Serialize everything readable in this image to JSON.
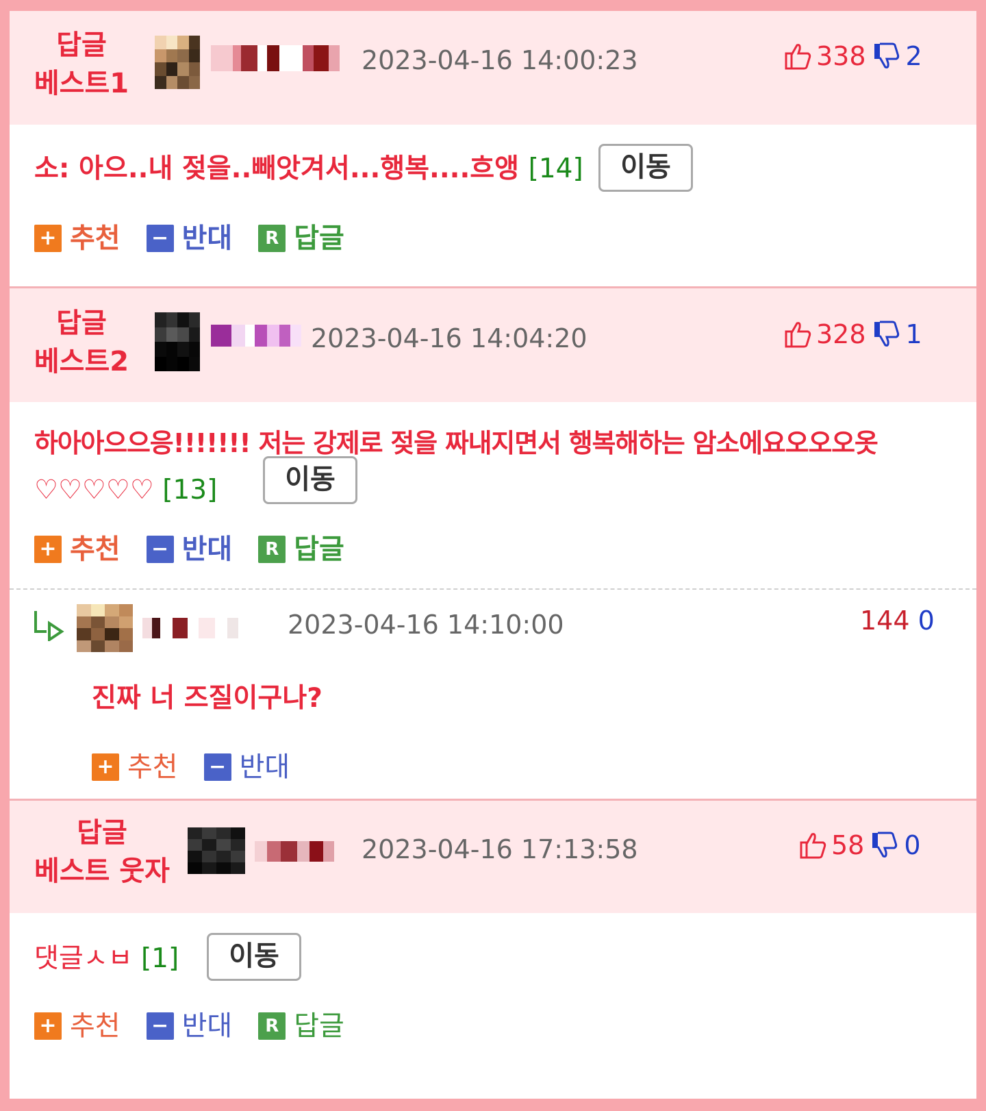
{
  "comments": [
    {
      "best_label_1": "답글",
      "best_label_2": "베스트1",
      "date": "2023-04-16 14:00:23",
      "up": "338",
      "down": "2",
      "text": "소: 아으..내 젖을..빼앗겨서...행복....흐앵",
      "count": "[14]",
      "move": "이동",
      "recommend": "추천",
      "oppose": "반대",
      "reply": "답글"
    },
    {
      "best_label_1": "답글",
      "best_label_2": "베스트2",
      "date": "2023-04-16 14:04:20",
      "up": "328",
      "down": "1",
      "text_line1": "하아아으으응!!!!!!! 저는 강제로 젖을 짜내지면서 행복해하는 암소에요오오오옷",
      "text_line2": "♡♡♡♡♡",
      "count": "[13]",
      "move": "이동",
      "recommend": "추천",
      "oppose": "반대",
      "reply": "답글"
    },
    {
      "best_label_1": "답글",
      "best_label_2": "베스트 웃자",
      "date": "2023-04-16 17:13:58",
      "up": "58",
      "down": "0",
      "text": "댓글ㅅㅂ",
      "count": "[1]",
      "move": "이동",
      "recommend": "추천",
      "oppose": "반대",
      "reply": "답글"
    }
  ],
  "sub_reply": {
    "date": "2023-04-16 14:10:00",
    "up": "144",
    "down": "0",
    "text": "진짜 너 즈질이구나?",
    "recommend": "추천",
    "oppose": "반대"
  },
  "icons": {
    "up": "thumbs-up-icon",
    "down": "thumbs-down-icon",
    "reply_arrow": "reply-arrow-icon",
    "plus": "+",
    "minus": "−",
    "r": "R"
  },
  "colors": {
    "accent_red": "#e8283c",
    "accent_blue": "#1f3cc7",
    "count_green": "#1a8a1a",
    "header_bg": "#ffe8ea",
    "border_pink": "#f8a7ad"
  }
}
